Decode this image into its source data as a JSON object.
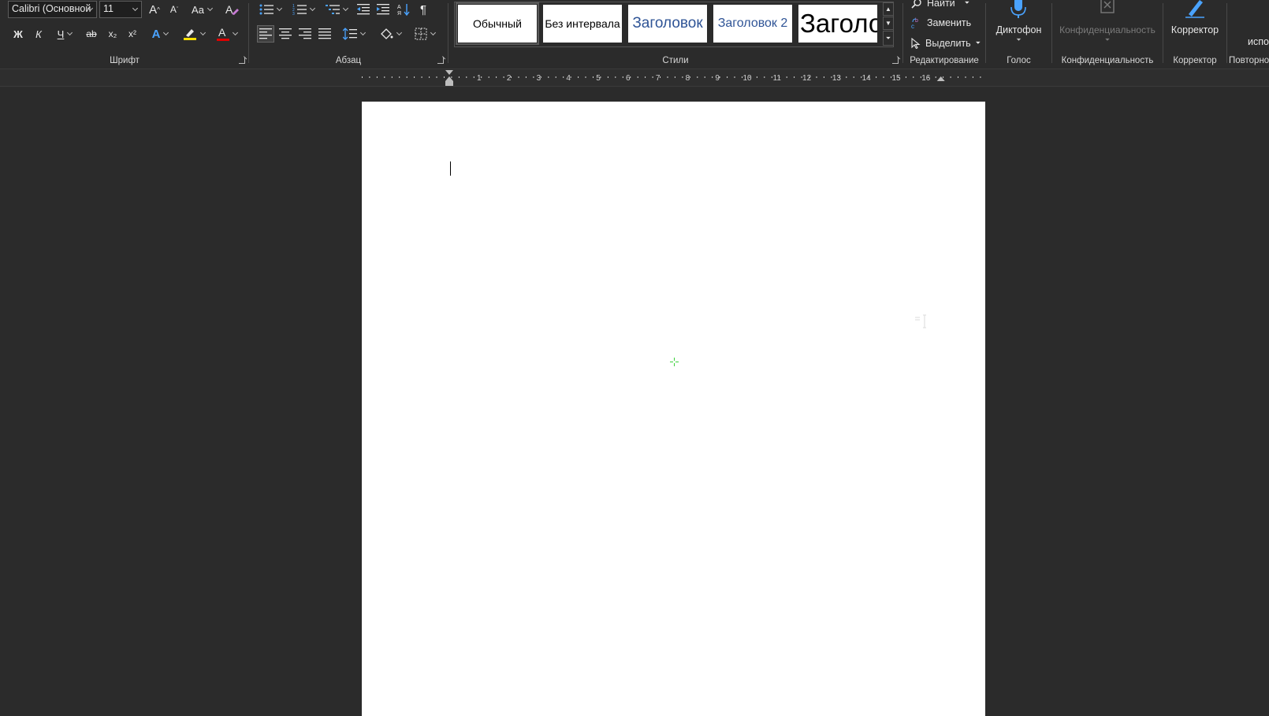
{
  "font_group": {
    "label": "Шрифт",
    "font_name": "Calibri (Основной",
    "font_size": "11",
    "bold": "Ж",
    "italic": "К",
    "underline": "Ч",
    "strike": "ab",
    "subscript": "x₂",
    "superscript": "x²",
    "grow": "A",
    "shrink": "A",
    "change_case": "Aa",
    "text_effects": "A",
    "font_color": "A",
    "highlight_color": "#ffe000",
    "font_color_bar": "#e00000"
  },
  "paragraph_group": {
    "label": "Абзац",
    "pilcrow": "¶"
  },
  "styles_group": {
    "label": "Стили",
    "items": [
      {
        "label": "Обычный"
      },
      {
        "label": "Без интервала"
      },
      {
        "label": "Заголовок"
      },
      {
        "label": "Заголовок 2"
      },
      {
        "label": "Заголо"
      }
    ]
  },
  "editing_group": {
    "label": "Редактирование",
    "find": "Найти",
    "replace": "Заменить",
    "select": "Выделить"
  },
  "voice_group": {
    "label": "Голос",
    "dictate": "Диктофон"
  },
  "privacy_group": {
    "label": "Конфиденциальность",
    "button": "Конфиденциальность"
  },
  "editor_group": {
    "label": "Корректор",
    "button": "Корректор"
  },
  "reuse_group": {
    "label": "Повторно",
    "button": "испо"
  },
  "ruler": {
    "numbers": [
      "1",
      "2",
      "3",
      "4",
      "5",
      "6",
      "7",
      "8",
      "9",
      "10",
      "11",
      "12",
      "13",
      "14",
      "15",
      "16"
    ],
    "indent_position": 0,
    "right_indent_position": 16.5
  },
  "colors": {
    "accent": "#4aa3ff",
    "ribbon_bg": "#2b2b2b",
    "page_bg": "#ffffff",
    "heading_blue": "#2f5496"
  }
}
